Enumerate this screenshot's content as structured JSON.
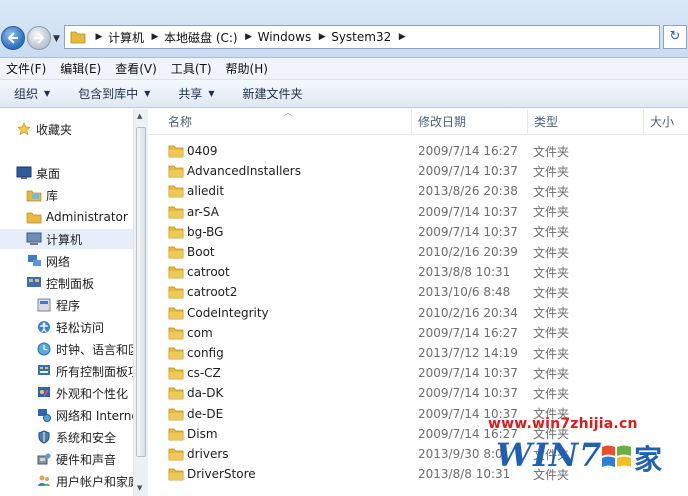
{
  "address": {
    "crumbs": [
      "计算机",
      "本地磁盘 (C:)",
      "Windows",
      "System32"
    ]
  },
  "menu": [
    "文件(F)",
    "编辑(E)",
    "查看(V)",
    "工具(T)",
    "帮助(H)"
  ],
  "toolbar": {
    "organize": "组织",
    "include_library": "包含到库中",
    "share": "共享",
    "new_folder": "新建文件夹"
  },
  "nav": {
    "favorites": "收藏夹",
    "desktop": "桌面",
    "libraries": "库",
    "administrator": "Administrator",
    "computer": "计算机",
    "network": "网络",
    "control_panel": "控制面板",
    "cp_items": [
      "程序",
      "轻松访问",
      "时钟、语言和区",
      "所有控制面板项",
      "外观和个性化",
      "网络和 Interne",
      "系统和安全",
      "硬件和声音",
      "用户帐户和家庭"
    ]
  },
  "columns": {
    "name": "名称",
    "modified": "修改日期",
    "type": "类型",
    "size": "大小"
  },
  "files": [
    {
      "name": "0409",
      "date": "2009/7/14 16:27",
      "type": "文件夹"
    },
    {
      "name": "AdvancedInstallers",
      "date": "2009/7/14 10:37",
      "type": "文件夹"
    },
    {
      "name": "aliedit",
      "date": "2013/8/26 20:38",
      "type": "文件夹"
    },
    {
      "name": "ar-SA",
      "date": "2009/7/14 10:37",
      "type": "文件夹"
    },
    {
      "name": "bg-BG",
      "date": "2009/7/14 10:37",
      "type": "文件夹"
    },
    {
      "name": "Boot",
      "date": "2010/2/16 20:39",
      "type": "文件夹"
    },
    {
      "name": "catroot",
      "date": "2013/8/8 10:31",
      "type": "文件夹"
    },
    {
      "name": "catroot2",
      "date": "2013/10/6 8:48",
      "type": "文件夹"
    },
    {
      "name": "CodeIntegrity",
      "date": "2010/2/16 20:34",
      "type": "文件夹"
    },
    {
      "name": "com",
      "date": "2009/7/14 16:27",
      "type": "文件夹"
    },
    {
      "name": "config",
      "date": "2013/7/12 14:19",
      "type": "文件夹"
    },
    {
      "name": "cs-CZ",
      "date": "2009/7/14 10:37",
      "type": "文件夹"
    },
    {
      "name": "da-DK",
      "date": "2009/7/14 10:37",
      "type": "文件夹"
    },
    {
      "name": "de-DE",
      "date": "2009/7/14 10:37",
      "type": "文件夹"
    },
    {
      "name": "Dism",
      "date": "2009/7/14 16:27",
      "type": "文件夹"
    },
    {
      "name": "drivers",
      "date": "2013/9/30 8:0",
      "type": "文件夹"
    },
    {
      "name": "DriverStore",
      "date": "2013/8/8 10:31",
      "type": "文件夹"
    }
  ],
  "watermark": {
    "url": "www.win7zhijia.cn",
    "logo": "WIN7",
    "jia": "家"
  },
  "colors": {
    "folder": "#e8b93a",
    "selected_bg": "#e5eef9",
    "watermark_red": "#e01a1a",
    "watermark_blue": "#1f5fb4"
  }
}
